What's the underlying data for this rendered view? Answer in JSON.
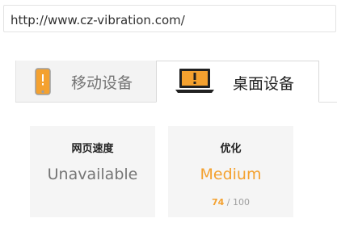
{
  "url_bar": {
    "value": "http://www.cz-vibration.com/"
  },
  "tabs": [
    {
      "label": "移动设备",
      "icon": "mobile-phone-icon",
      "selected": false
    },
    {
      "label": "桌面设备",
      "icon": "laptop-icon",
      "selected": true
    }
  ],
  "cards": {
    "speed": {
      "title": "网页速度",
      "value": "Unavailable"
    },
    "optimization": {
      "title": "优化",
      "value": "Medium",
      "score": "74",
      "score_max": "/ 100"
    }
  },
  "colors": {
    "accent_orange": "#f4a12f",
    "card_bg": "#f5f5f5",
    "muted_text": "#757575"
  }
}
